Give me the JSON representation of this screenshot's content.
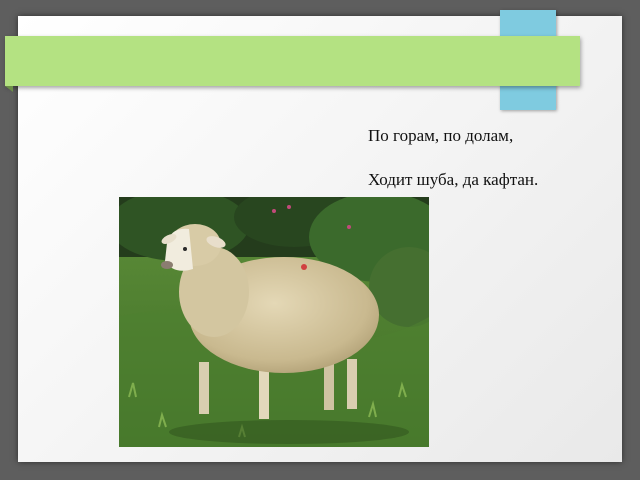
{
  "slide": {
    "colors": {
      "background": "#5e5e5e",
      "title_bar": "#b4e282",
      "accent_tab": "#7fcbe0"
    },
    "poem": {
      "lines": [
        "По горам, по долам,",
        "Ходит шуба, да кафтан."
      ]
    },
    "image": {
      "subject": "sheep-photo"
    }
  }
}
